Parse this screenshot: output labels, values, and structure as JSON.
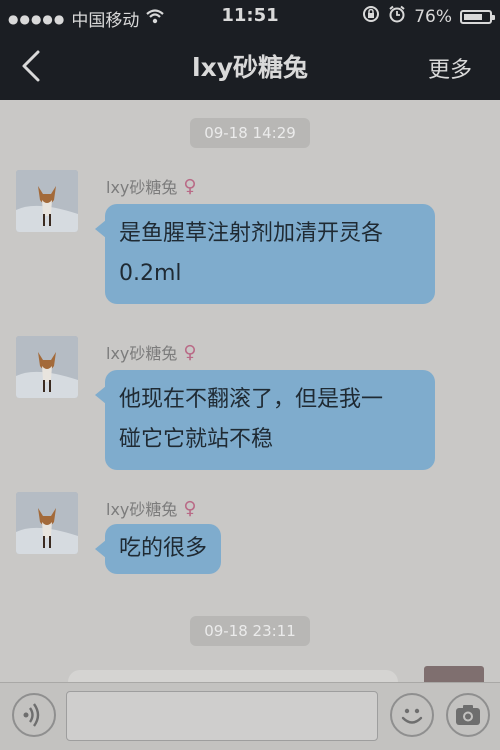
{
  "statusbar": {
    "signal": "●●●●●",
    "carrier": "中国移动",
    "time": "11:51",
    "battery": "76%",
    "battery_level": 0.76
  },
  "navbar": {
    "title": "lxy砂糖兔",
    "more": "更多"
  },
  "messages": [
    {
      "sender": "lxy砂糖兔",
      "gender": "♀",
      "lines": [
        "是鱼腥草注射剂加清开灵各",
        "0.2ml"
      ]
    },
    {
      "sender": "lxy砂糖兔",
      "gender": "♀",
      "lines": [
        "他现在不翻滚了，但是我一",
        "碰它它就站不稳"
      ]
    },
    {
      "sender": "lxy砂糖兔",
      "gender": "♀",
      "lines": [
        "吃的很多"
      ]
    }
  ],
  "timestamps": [
    "09-18 14:29",
    "09-18 23:11"
  ],
  "input": {
    "placeholder": ""
  },
  "icons": {
    "back": "chevron-left-icon",
    "voice": "voice-icon",
    "emoji": "emoji-icon",
    "camera": "camera-icon",
    "wifi": "wifi-icon",
    "lock": "rotation-lock-icon",
    "alarm": "alarm-icon"
  }
}
